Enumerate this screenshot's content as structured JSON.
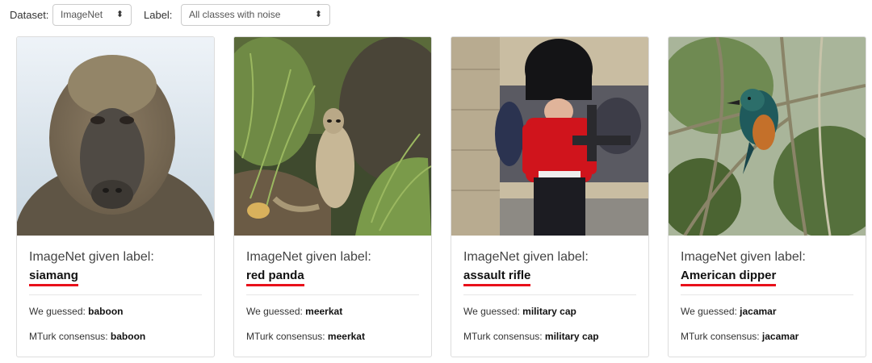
{
  "toolbar": {
    "dataset_label": "Dataset:",
    "dataset_value": "ImageNet",
    "label_label": "Label:",
    "label_value": "All classes with noise"
  },
  "cards": [
    {
      "given_prefix": "ImageNet given label:",
      "given_label": "siamang",
      "guess_prefix": "We guessed: ",
      "guess": "baboon",
      "mturk_prefix": "MTurk consensus: ",
      "mturk": "baboon",
      "image": "baboon-photo"
    },
    {
      "given_prefix": "ImageNet given label:",
      "given_label": "red panda",
      "guess_prefix": "We guessed: ",
      "guess": "meerkat",
      "mturk_prefix": "MTurk consensus: ",
      "mturk": "meerkat",
      "image": "meerkat-photo"
    },
    {
      "given_prefix": "ImageNet given label:",
      "given_label": "assault rifle",
      "guess_prefix": "We guessed: ",
      "guess": "military cap",
      "mturk_prefix": "MTurk consensus: ",
      "mturk": "military cap",
      "image": "royal-guard-photo"
    },
    {
      "given_prefix": "ImageNet given label:",
      "given_label": "American dipper",
      "guess_prefix": "We guessed: ",
      "guess": "jacamar",
      "mturk_prefix": "MTurk consensus: ",
      "mturk": "jacamar",
      "image": "kingfisher-bird-photo"
    }
  ],
  "colors": {
    "label_underline": "#e8101a",
    "border": "#dddddd"
  }
}
